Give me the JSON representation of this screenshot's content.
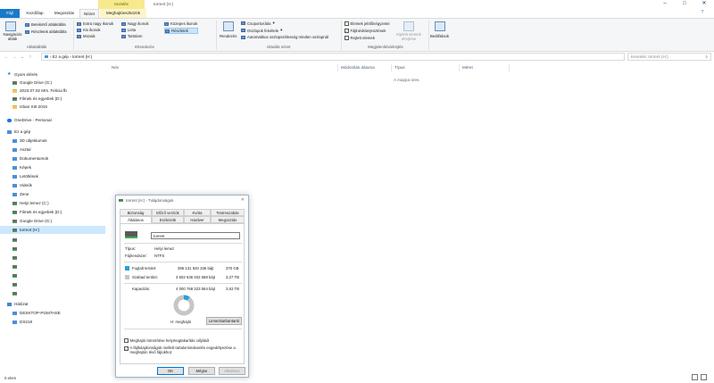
{
  "window": {
    "context_tab": "Kezelés",
    "title": "torrent (H:)",
    "controls": {
      "minimize": "–",
      "maximize": "□",
      "close": "✕"
    }
  },
  "ribbon_tabs": [
    "Fájl",
    "Kezdőlap",
    "Megosztás",
    "Nézet",
    "Meghajtóeszközök"
  ],
  "ribbon": {
    "panes": {
      "label": "Ablaktáblák",
      "nav_pane": "Navigációs ablak",
      "preview": "Betekintő ablaktábla",
      "details": "Részletek ablaktábla"
    },
    "layout": {
      "label": "Elrendezés",
      "items": [
        "Extra nagy ikonok",
        "Nagy ikonok",
        "Közepes ikonok",
        "Kis ikonok",
        "Lista",
        "Részletek",
        "Mozaik",
        "Tartalom"
      ]
    },
    "current_view": {
      "label": "Aktuális nézet",
      "sort": "Rendezés",
      "group_by": "Csoportosítás",
      "add_columns": "Oszlopok felvétele",
      "fit_columns": "Automatikus oszlopszélesség minden oszlopnál"
    },
    "show_hide": {
      "label": "Megjelenítés/elrejtés",
      "item_checkboxes": "Elemek jelölőnégyzetei",
      "file_extensions": "Fájlnévkiterjesztések",
      "hidden_items": "Rejtett elemek",
      "hide_selected": "Kijelölt elemek elrejtése"
    },
    "options": "Beállítások"
  },
  "address": {
    "back": "←",
    "forward": "→",
    "recent": "⌄",
    "up": "↑",
    "path": "›  Ez a gép  ›  torrent (H:)",
    "search_placeholder": "Keresés: torrent (H:)"
  },
  "nav": {
    "quick_access": "Gyors elérés",
    "quick_items": [
      "Google Drive (G:)",
      "2023.07.02 Mrs. Felicia fb",
      "Filmek és egyebek (D:)",
      "Izban XIII 2016"
    ],
    "onedrive": "OneDrive - Personal",
    "this_pc": "Ez a gép",
    "pc_items": [
      "3D objektumok",
      "Asztal",
      "Dokumentumok",
      "Képek",
      "Letöltések",
      "Videók",
      "Zene",
      "Helyi lemez (C:)",
      "Filmek és egyebek (D:)",
      "Google Drive (G:)",
      "torrent (H:)"
    ],
    "network": "Hálózat",
    "network_items": [
      "DESKTOP-PGM7HSE",
      "DS218"
    ]
  },
  "columns": [
    "Név",
    "Módosítás dátuma",
    "Típus",
    "Méret"
  ],
  "empty_message": "A mappa üres.",
  "status": "0 elem",
  "dialog": {
    "title": "torrent (H:) - Tulajdonságok",
    "close": "✕",
    "tabs_row1": [
      "Biztonság",
      "Előző verziók",
      "Kvóta",
      "Testreszabás"
    ],
    "tabs_row2": [
      "Általános",
      "Eszközök",
      "Hardver",
      "Megosztás"
    ],
    "name": "torrent",
    "type_label": "Típus:",
    "type_value": "Helyi lemez",
    "fs_label": "Fájlrendszer:",
    "fs_value": "NTFS",
    "used_label": "Foglalt terület:",
    "used_bytes": "395 131 920 336 bájt",
    "used_size": "370 GB",
    "free_label": "Szabad terület:",
    "free_bytes": "3 602 636 402 688 bájt",
    "free_size": "3,27 TB",
    "capacity_label": "Kapacitás:",
    "capacity_bytes": "4 000 768 323 584 bájt",
    "capacity_size": "3,63 TB",
    "drive_label": "H: meghajtó",
    "cleanup": "Lemezkarbantartó",
    "compress": "Meghajtó tömörítése helymegtakarítás céljából",
    "index": "A fájltulajdonságok mellett tartalomindexelés engedélyezése a meghajtón lévő fájlokhoz",
    "ok": "OK",
    "cancel": "Mégse",
    "apply": "Alkalmaz",
    "used_fraction": 0.099,
    "colors": {
      "used": "#26a0da",
      "free": "#c6c6c6"
    }
  }
}
